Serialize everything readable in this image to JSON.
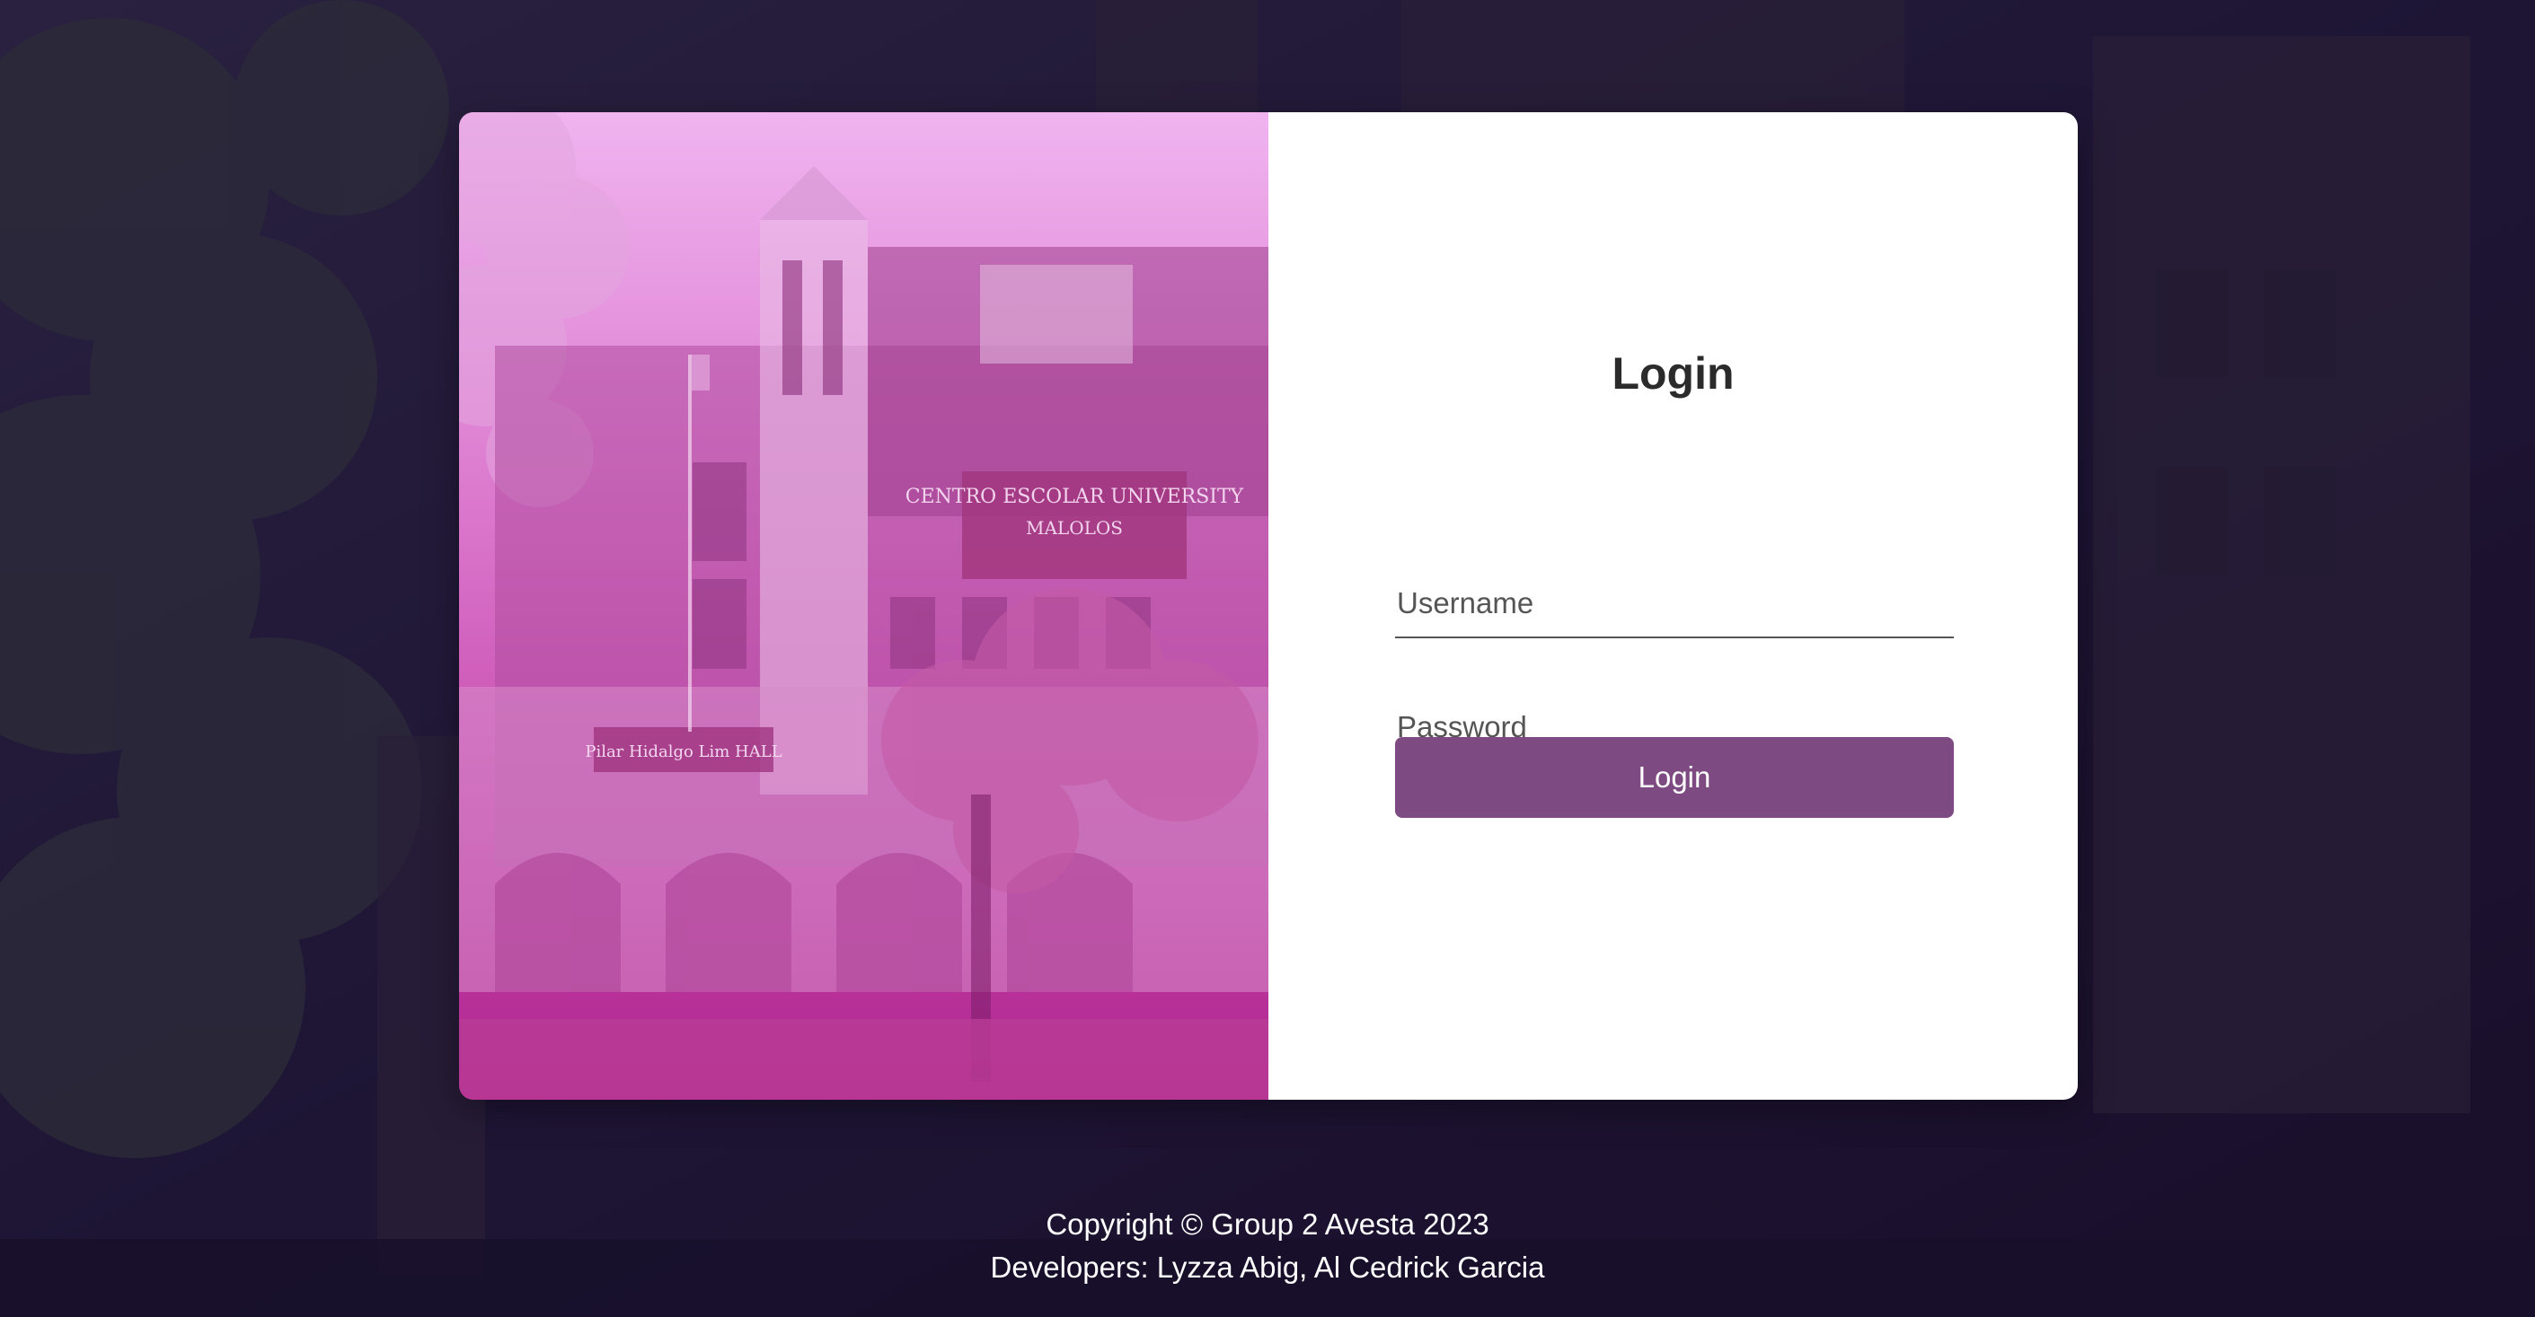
{
  "login_form": {
    "title": "Login",
    "username_placeholder": "Username",
    "password_placeholder": "Password",
    "submit_label": "Login"
  },
  "footer": {
    "copyright": "Copyright © Group 2 Avesta 2023",
    "developers": "Developers: Lyzza Abig, Al Cedrick Garcia"
  },
  "image_panel": {
    "sign_line1": "CENTRO ESCOLAR UNIVERSITY",
    "sign_line2": "MALOLOS",
    "hall_sign": "Pilar Hidalgo Lim HALL"
  },
  "colors": {
    "background": "#1c1433",
    "panel_gradient_top": "#f0b4f0",
    "panel_gradient_bottom": "#b0228e",
    "button": "#7d4b82",
    "card": "#ffffff"
  }
}
